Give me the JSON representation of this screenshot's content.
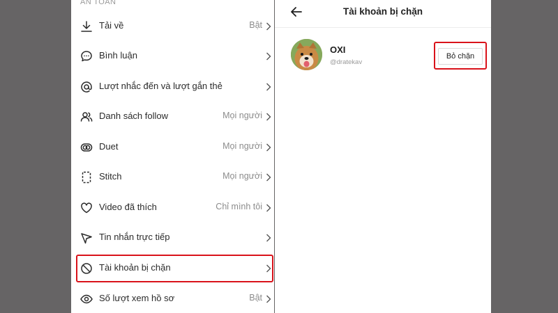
{
  "settings": {
    "section_header": "AN TOÀN",
    "items": [
      {
        "icon": "download-icon",
        "label": "Tải về",
        "value": "Bật"
      },
      {
        "icon": "comment-icon",
        "label": "Bình luận",
        "value": ""
      },
      {
        "icon": "at-sign-icon",
        "label": "Lượt nhắc đến và lượt gắn thẻ",
        "value": ""
      },
      {
        "icon": "users-icon",
        "label": "Danh sách follow",
        "value": "Mọi người"
      },
      {
        "icon": "duet-icon",
        "label": "Duet",
        "value": "Mọi người"
      },
      {
        "icon": "stitch-icon",
        "label": "Stitch",
        "value": "Mọi người"
      },
      {
        "icon": "heart-icon",
        "label": "Video đã thích",
        "value": "Chỉ mình tôi"
      },
      {
        "icon": "send-icon",
        "label": "Tin nhắn trực tiếp",
        "value": ""
      },
      {
        "icon": "block-icon",
        "label": "Tài khoản bị chặn",
        "value": ""
      },
      {
        "icon": "eye-icon",
        "label": "Số lượt xem hồ sơ",
        "value": "Bật"
      }
    ]
  },
  "blocked_page": {
    "title": "Tài khoản bị chặn",
    "account": {
      "name": "OXI",
      "handle": "@dratekav",
      "unblock_label": "Bỏ chặn"
    }
  },
  "colors": {
    "highlight": "#d9121a",
    "backdrop": "#666465"
  }
}
